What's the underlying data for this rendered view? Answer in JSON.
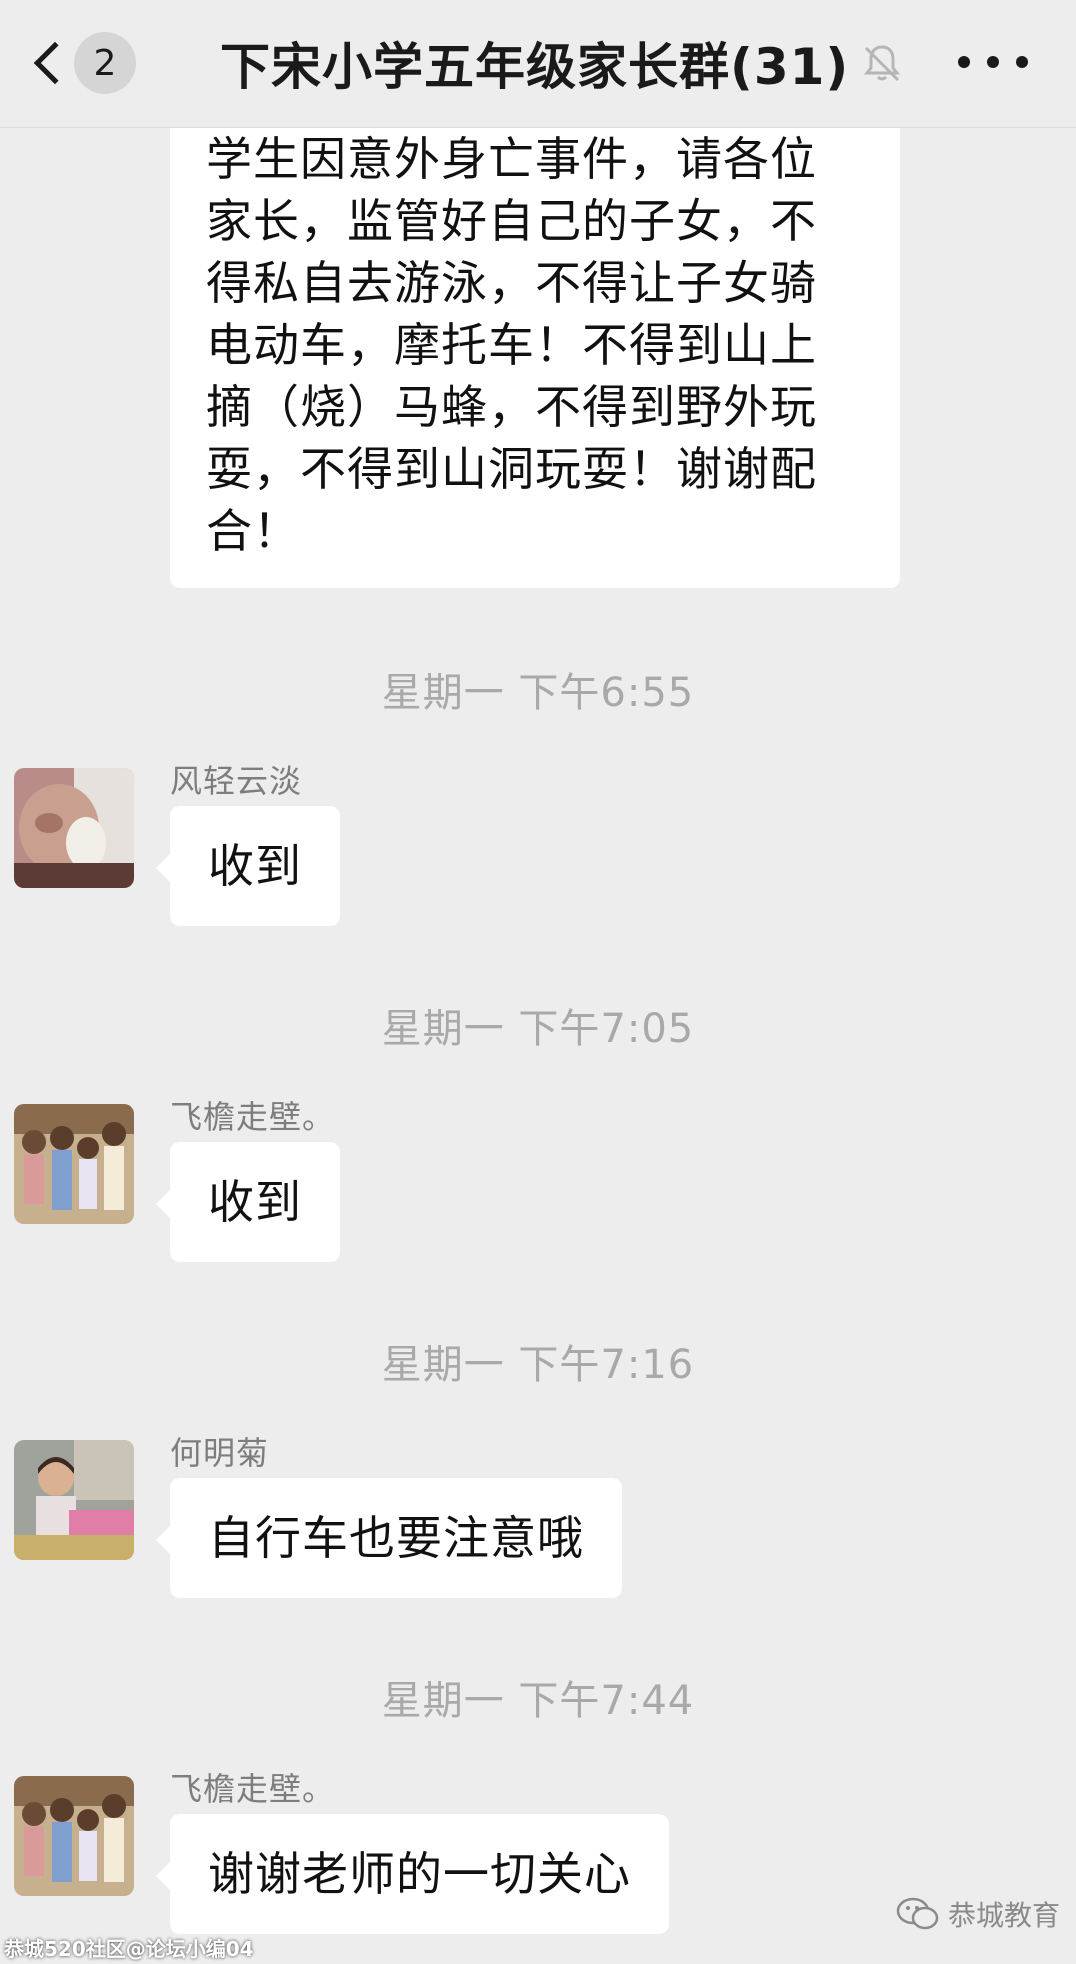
{
  "header": {
    "unread_count": "2",
    "title": "下宋小学五年级家长群(31)"
  },
  "messages": {
    "first": {
      "lines": [
        "学生因意外身亡事件，请各位",
        "家长，监管好自己的子女，不",
        "得私自去游泳，不得让子女骑",
        "电动车，摩托车！不得到山上",
        "摘（烧）马蜂，不得到野外玩",
        "耍，不得到山洞玩耍！谢谢配",
        "合！"
      ]
    },
    "items": [
      {
        "time": "星期一 下午6:55",
        "sender": "风轻云淡",
        "text": "收到"
      },
      {
        "time": "星期一 下午7:05",
        "sender": "飞檐走壁。",
        "text": "收到"
      },
      {
        "time": "星期一 下午7:16",
        "sender": "何明菊",
        "text": "自行车也要注意哦"
      },
      {
        "time": "星期一 下午7:44",
        "sender": "飞檐走壁。",
        "text": "谢谢老师的一切关心"
      }
    ]
  },
  "watermark": {
    "left": "恭城520社区@论坛小编04",
    "right": "恭城教育"
  },
  "colors": {
    "background": "#ededed",
    "bubble": "#ffffff",
    "timestamp": "#a9a9a9",
    "sender": "#7d7d7d"
  },
  "icons": [
    "back-chevron-icon",
    "mute-bell-icon",
    "more-icon",
    "wechat-icon"
  ]
}
